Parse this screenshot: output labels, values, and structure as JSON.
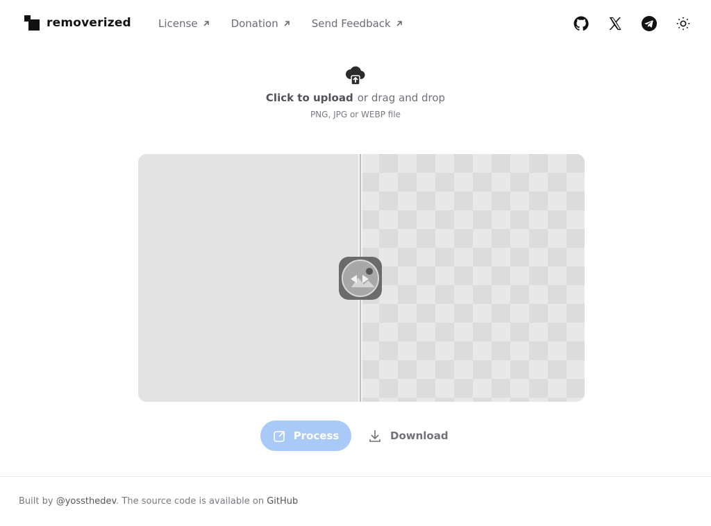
{
  "header": {
    "brand": "removerized",
    "nav": [
      {
        "label": "License"
      },
      {
        "label": "Donation"
      },
      {
        "label": "Send Feedback"
      }
    ],
    "icons": [
      "github-icon",
      "x-icon",
      "telegram-icon",
      "sun-icon"
    ]
  },
  "upload": {
    "cta": "Click to upload",
    "rest": "or drag and drop",
    "hint": "PNG, JPG or WEBP file"
  },
  "actions": {
    "process_label": "Process",
    "download_label": "Download"
  },
  "footer": {
    "prefix": "Built by ",
    "author": "@yossthedev",
    "middle": ". The source code is available on ",
    "source": "GitHub"
  },
  "colors": {
    "accent": "#a9c9f7",
    "text": "#3f3f46",
    "muted": "#71717a"
  }
}
